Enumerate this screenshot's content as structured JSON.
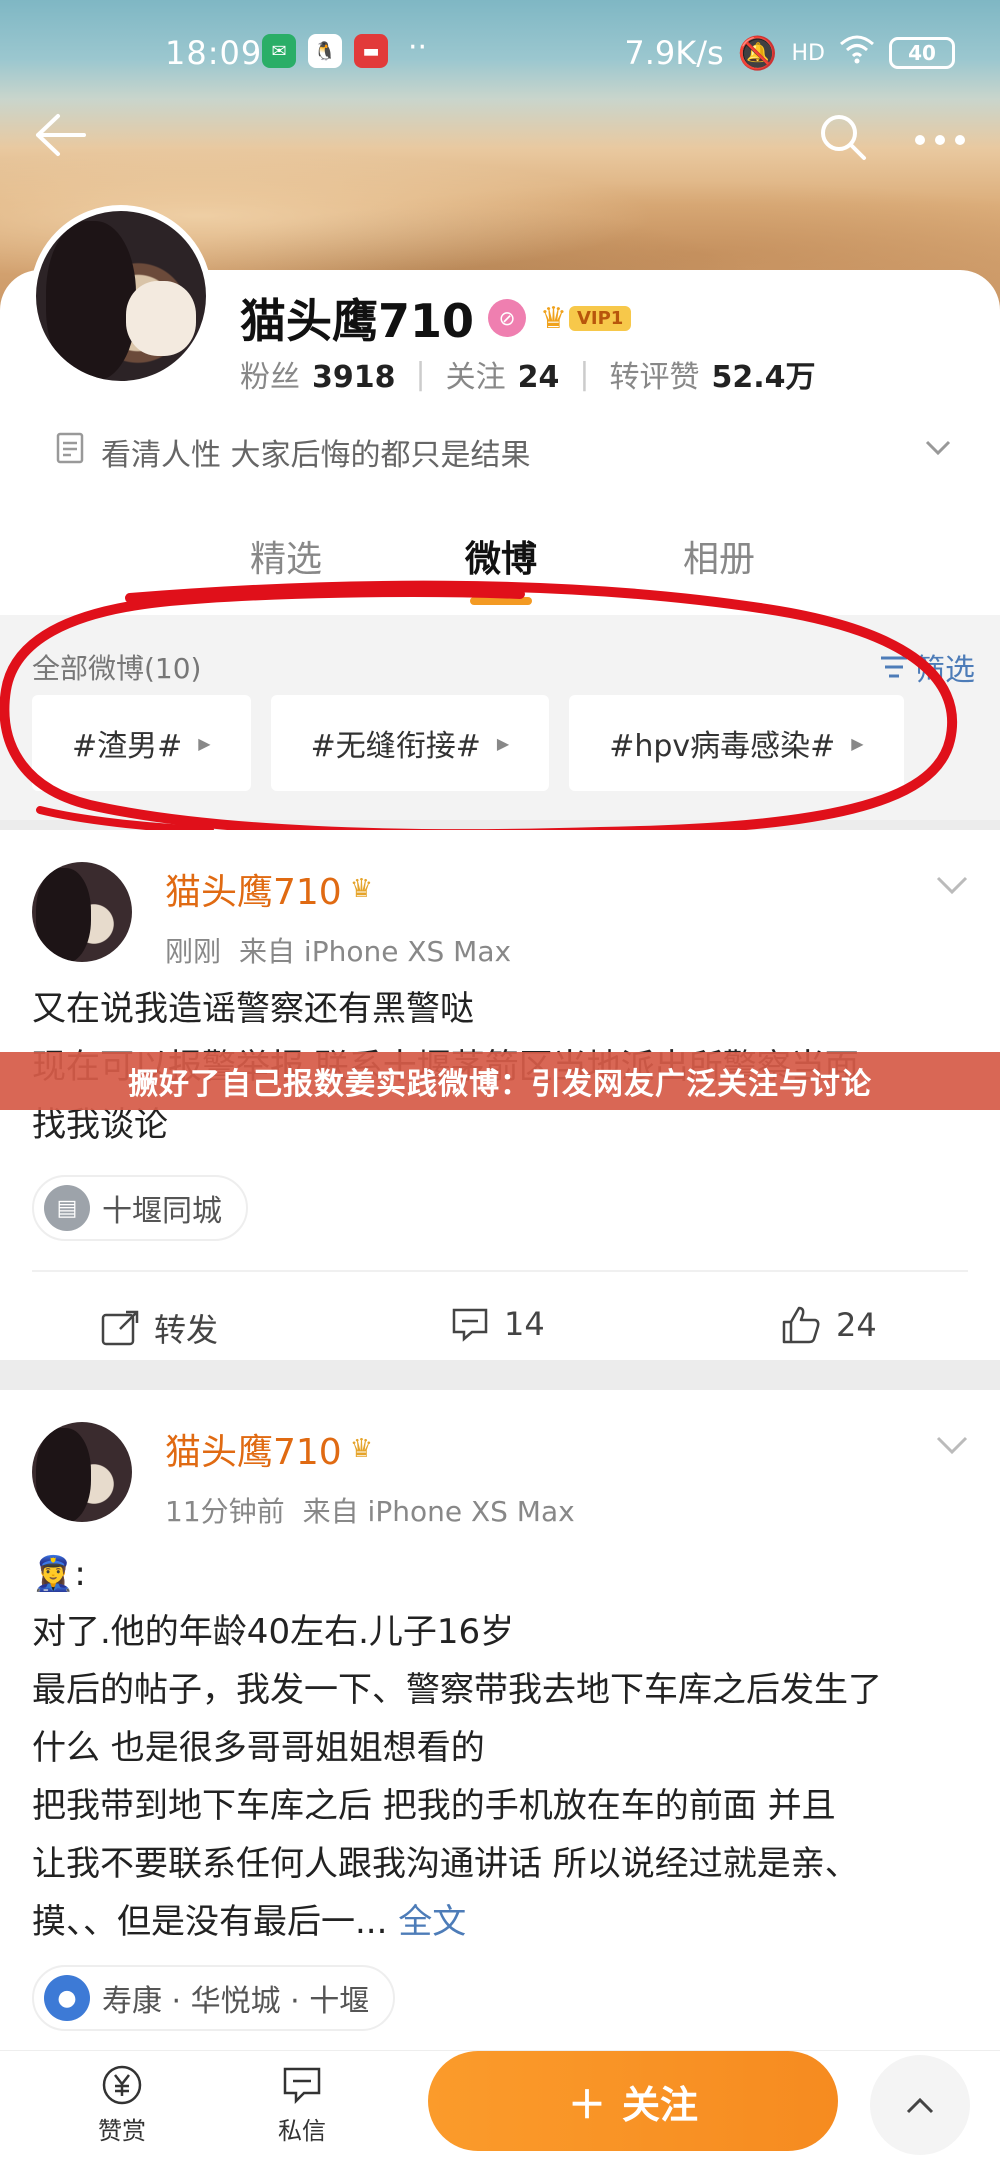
{
  "status_bar": {
    "time": "18:09",
    "network_speed": "7.9K/s",
    "network_type": "HD",
    "battery": "40"
  },
  "profile": {
    "username": "猫头鹰710",
    "vip_label": "VIP1",
    "stats": [
      {
        "label": "粉丝",
        "value": "3918"
      },
      {
        "label": "关注",
        "value": "24"
      },
      {
        "label": "转评赞",
        "value": "52.4万"
      }
    ],
    "bio": "看清人性 大家后悔的都只是结果"
  },
  "tabs": [
    "精选",
    "微博",
    "相册"
  ],
  "active_tab": "微博",
  "filter": {
    "all_posts": "全部微博(10)",
    "filter_label": "筛选",
    "chips": [
      "#渣男#",
      "#无缝衔接#",
      "#hpv病毒感染#"
    ]
  },
  "posts": [
    {
      "author": "猫头鹰710",
      "time": "刚刚",
      "source": "来自 iPhone XS Max",
      "lines": [
        "又在说我造谣警察还有黑警哒",
        "现在可以报警举报 联系十堰茅箭区当地派出所警察当面",
        "找我谈论"
      ],
      "location": "十堰同城",
      "actions": {
        "repost": "转发",
        "comments": "14",
        "likes": "24"
      }
    },
    {
      "author": "猫头鹰710",
      "time": "11分钟前",
      "source": "来自 iPhone XS Max",
      "lines": [
        "👮‍♀️:",
        "对了.他的年龄40左右.儿子16岁",
        "最后的帖子，我发一下、警察带我去地下车库之后发生了",
        "什么 也是很多哥哥姐姐想看的",
        "把我带到地下车库之后 把我的手机放在车的前面 并且",
        "让我不要联系任何人跟我沟通讲话 所以说经过就是亲、",
        "摸、、但是没有最后一..."
      ],
      "more_label": "全文",
      "location": "寿康 · 华悦城 · 十堰"
    }
  ],
  "banner": "撅好了自己报数姜实践微博：引发网友广泛关注与讨论",
  "bottom_bar": {
    "reward": "赞赏",
    "message": "私信",
    "follow": "关注"
  },
  "colors": {
    "accent": "#f39a23",
    "link": "#4d7cb8",
    "name": "#e06a12",
    "circle": "#e0101a"
  }
}
